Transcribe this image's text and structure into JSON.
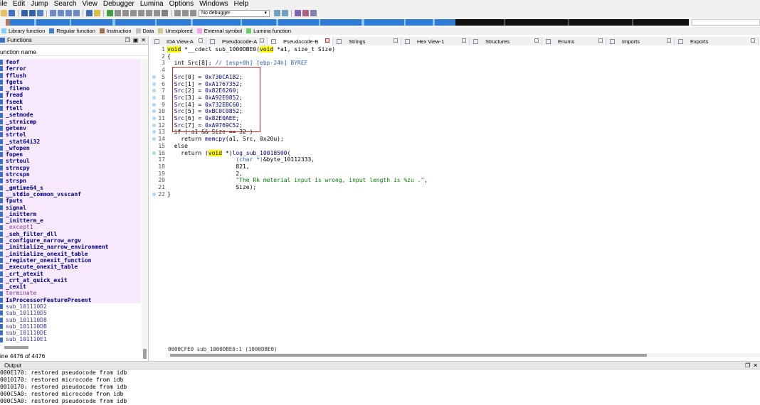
{
  "menu": [
    "ile",
    "Edit",
    "Jump",
    "Search",
    "View",
    "Debugger",
    "Lumina",
    "Options",
    "Windows",
    "Help"
  ],
  "toolbar": {
    "debugger_select": "No debugger"
  },
  "navband": {
    "colors": {
      "blue": "#2e7bd6",
      "light_blue": "#8cc3ea",
      "dark": "#101010",
      "brown": "#b07a58"
    }
  },
  "legend": [
    {
      "label": "Library function",
      "color": "#7fd0ff"
    },
    {
      "label": "Regular function",
      "color": "#3a7fd0"
    },
    {
      "label": "Instruction",
      "color": "#a0704c"
    },
    {
      "label": "Data",
      "color": "#c0c0c0"
    },
    {
      "label": "Unexplored",
      "color": "#c8c890"
    },
    {
      "label": "External symbol",
      "color": "#ff9ee8"
    },
    {
      "label": "Lumina function",
      "color": "#66d066"
    }
  ],
  "functions_panel": {
    "title": "Functions",
    "column_header": "unction name",
    "status": "ine 4476 of 4476",
    "items": [
      {
        "name": "feof",
        "kind": "lib"
      },
      {
        "name": "ferror",
        "kind": "lib"
      },
      {
        "name": "fflush",
        "kind": "lib"
      },
      {
        "name": "fgets",
        "kind": "lib"
      },
      {
        "name": "_fileno",
        "kind": "lib"
      },
      {
        "name": "fread",
        "kind": "lib"
      },
      {
        "name": "fseek",
        "kind": "lib"
      },
      {
        "name": "ftell",
        "kind": "lib"
      },
      {
        "name": "_setmode",
        "kind": "lib"
      },
      {
        "name": "_strnicmp",
        "kind": "lib"
      },
      {
        "name": "getenv",
        "kind": "lib"
      },
      {
        "name": "strtol",
        "kind": "lib"
      },
      {
        "name": "_stat64i32",
        "kind": "lib"
      },
      {
        "name": "_wfopen",
        "kind": "lib"
      },
      {
        "name": "fopen",
        "kind": "lib"
      },
      {
        "name": "strtoul",
        "kind": "lib"
      },
      {
        "name": "strncpy",
        "kind": "lib"
      },
      {
        "name": "strcspn",
        "kind": "lib"
      },
      {
        "name": "strspn",
        "kind": "lib"
      },
      {
        "name": "_gmtime64_s",
        "kind": "lib"
      },
      {
        "name": "__stdio_common_vsscanf",
        "kind": "lib"
      },
      {
        "name": "fputs",
        "kind": "lib"
      },
      {
        "name": "signal",
        "kind": "lib"
      },
      {
        "name": "_initterm",
        "kind": "lib"
      },
      {
        "name": "_initterm_e",
        "kind": "lib"
      },
      {
        "name": "_except1",
        "kind": "imp"
      },
      {
        "name": "_seh_filter_dll",
        "kind": "lib"
      },
      {
        "name": "_configure_narrow_argv",
        "kind": "lib"
      },
      {
        "name": "_initialize_narrow_environment",
        "kind": "lib"
      },
      {
        "name": "_initialize_onexit_table",
        "kind": "lib"
      },
      {
        "name": "_register_onexit_function",
        "kind": "lib"
      },
      {
        "name": "_execute_onexit_table",
        "kind": "lib"
      },
      {
        "name": "_crt_atexit",
        "kind": "lib"
      },
      {
        "name": "_crt_at_quick_exit",
        "kind": "lib"
      },
      {
        "name": "_cexit",
        "kind": "lib"
      },
      {
        "name": "terminate",
        "kind": "imp"
      },
      {
        "name": "IsProcessorFeaturePresent",
        "kind": "lib"
      },
      {
        "name": "sub_101110D2",
        "kind": "reg"
      },
      {
        "name": "sub_101110D5",
        "kind": "reg"
      },
      {
        "name": "sub_101110D8",
        "kind": "reg"
      },
      {
        "name": "sub_101110DB",
        "kind": "reg"
      },
      {
        "name": "sub_101110DE",
        "kind": "reg"
      },
      {
        "name": "sub_101110E1",
        "kind": "reg"
      }
    ]
  },
  "tabs": [
    {
      "label": "IDA View-A",
      "width": 78
    },
    {
      "label": "Pseudocode-A",
      "width": 86
    },
    {
      "label": "Pseudocode-B",
      "width": 92,
      "active": true
    },
    {
      "label": "Strings",
      "width": 96
    },
    {
      "label": "Hex View-1",
      "width": 96
    },
    {
      "label": "Structures",
      "width": 102
    },
    {
      "label": "Enums",
      "width": 90
    },
    {
      "label": "Imports",
      "width": 96
    },
    {
      "label": "Exports",
      "width": 118
    }
  ],
  "code": {
    "lines": [
      {
        "n": "1",
        "dot": false,
        "html": "<span class=\"kw hl\">void</span> *__cdecl sub_1000DBE0(<span class=\"kw hl\">void</span> *a1, size_t Size)"
      },
      {
        "n": "2",
        "dot": false,
        "html": "{"
      },
      {
        "n": "3",
        "dot": false,
        "html": "  int Src[8]; <span class=\"cm\">// [esp+0h] [ebp-24h] BYREF</span>"
      },
      {
        "n": "4",
        "dot": false,
        "html": ""
      },
      {
        "n": "5",
        "dot": true,
        "html": "  <span class=\"var\">Src</span>[0] = <span class=\"var\">0x730CA1B2</span>;"
      },
      {
        "n": "6",
        "dot": true,
        "html": "  <span class=\"var\">Src</span>[1] = <span class=\"var\">0xA1767352</span>;"
      },
      {
        "n": "7",
        "dot": true,
        "html": "  <span class=\"var\">Src</span>[2] = <span class=\"var\">0x82E6260</span>;"
      },
      {
        "n": "8",
        "dot": true,
        "html": "  <span class=\"var\">Src</span>[3] = <span class=\"var\">0xA92E0852</span>;"
      },
      {
        "n": "9",
        "dot": true,
        "html": "  <span class=\"var\">Src</span>[4] = <span class=\"var\">0x732EBC60</span>;"
      },
      {
        "n": "10",
        "dot": true,
        "html": "  <span class=\"var\">Src</span>[5] = <span class=\"var\">0xBC0C0852</span>;"
      },
      {
        "n": "11",
        "dot": true,
        "html": "  <span class=\"var\">Src</span>[6] = <span class=\"var\">0x82E0AEE</span>;"
      },
      {
        "n": "12",
        "dot": true,
        "html": "  <span class=\"var\">Src</span>[7] = <span class=\"var\">0xA9769C52</span>;"
      },
      {
        "n": "13",
        "dot": true,
        "html": "  if ( a1 &amp;&amp; Size == 32 )"
      },
      {
        "n": "14",
        "dot": true,
        "html": "    return <span class=\"fn\">memcpy</span>(a1, Src, 0x20u);"
      },
      {
        "n": "15",
        "dot": false,
        "html": "  else"
      },
      {
        "n": "16",
        "dot": true,
        "html": "    return (<span class=\"kw hl\">void</span> *)<span class=\"fn\">log_sub_10018500</span>("
      },
      {
        "n": "17",
        "dot": false,
        "html": "                    <span class=\"cast\">(char *)</span>&amp;byte_10112333,"
      },
      {
        "n": "18",
        "dot": false,
        "html": "                    821,"
      },
      {
        "n": "19",
        "dot": false,
        "html": "                    2,"
      },
      {
        "n": "20",
        "dot": false,
        "html": "                    <span class=\"str\">\"The Rk meterial input is wrong, input length is %zu .\"</span>,"
      },
      {
        "n": "21",
        "dot": false,
        "html": "                    Size);"
      },
      {
        "n": "22",
        "dot": true,
        "html": "}"
      }
    ],
    "status": "0000CFE0 sub_1000DBE0:1 (1000DBE0)"
  },
  "output": {
    "title": "Output",
    "lines": [
      "000E170: restored pseudocode from idb",
      "0010170: restored microcode from idb",
      "0010170: restored pseudocode from idb",
      "000C5A0: restored microcode from idb",
      "000C5A0: restored pseudocode from idb"
    ]
  }
}
